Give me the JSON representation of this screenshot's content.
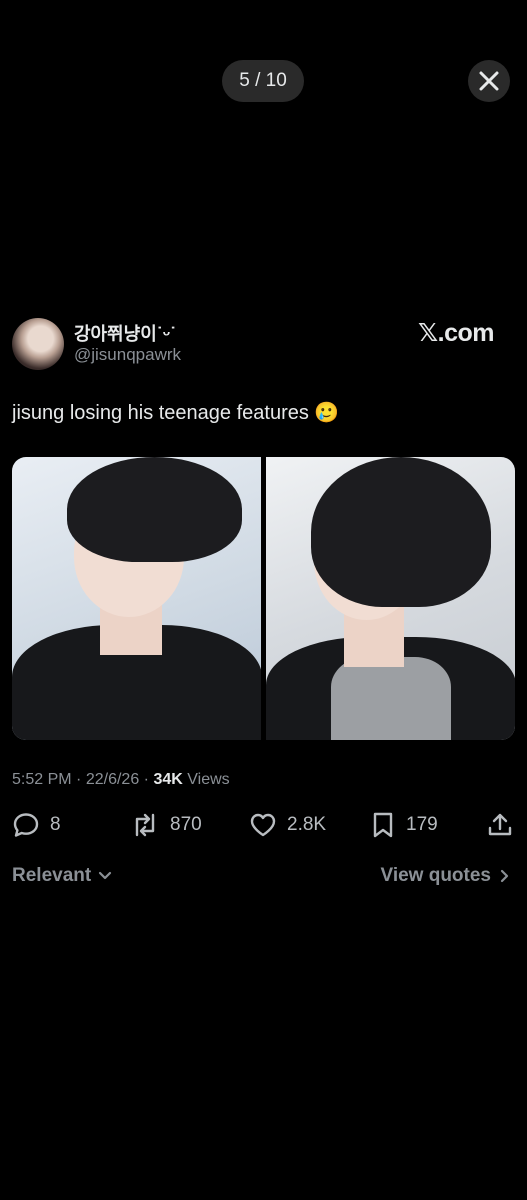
{
  "viewer": {
    "counter": "5 / 10"
  },
  "tweet": {
    "author_name": "강아쮜냥이˙ᵕ˙",
    "handle": "@jisunqpawrk",
    "brand": "𝕏.com",
    "text": "jisung losing his teenage features 🥲",
    "time": "5:52 PM",
    "date": "22/6/26",
    "views_count": "34K",
    "views_label": "Views",
    "separator": "·"
  },
  "actions": {
    "replies": "8",
    "reposts": "870",
    "likes": "2.8K",
    "bookmarks": "179"
  },
  "footer": {
    "sort_label": "Relevant",
    "quotes_label": "View quotes"
  },
  "colors": {
    "background": "#000000",
    "text_primary": "#e7e9ea",
    "text_secondary": "#8b9096",
    "pill": "#2a2a2a"
  }
}
